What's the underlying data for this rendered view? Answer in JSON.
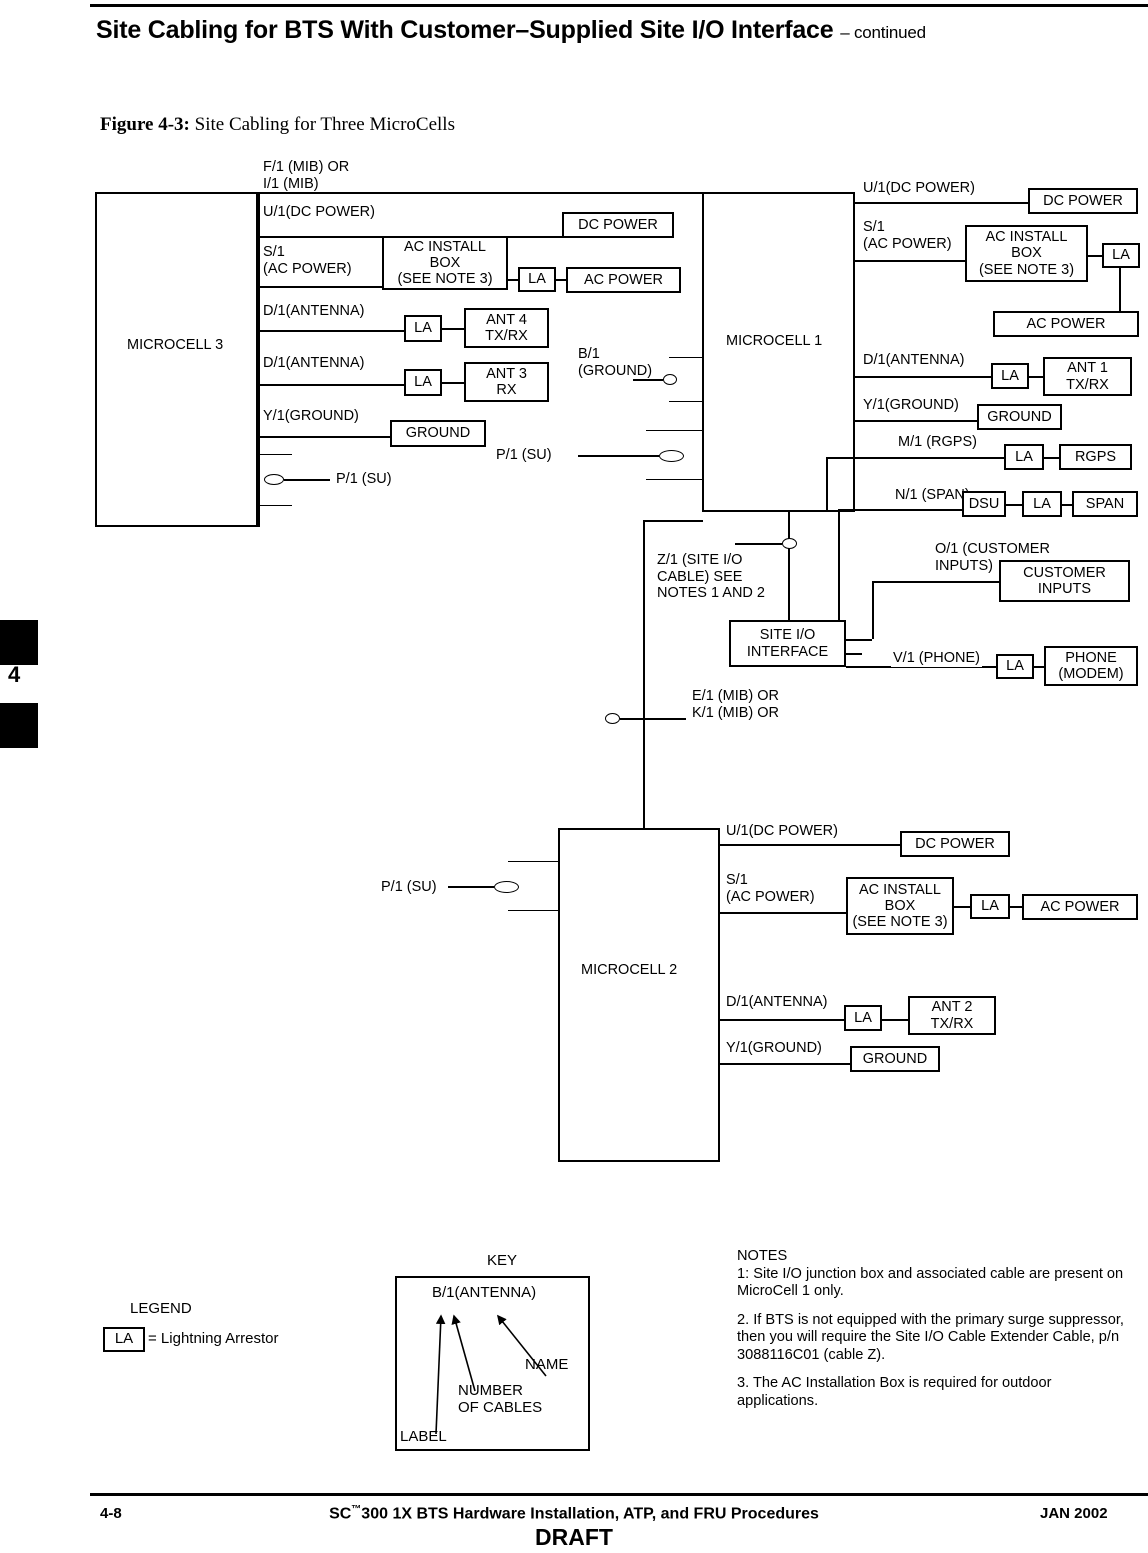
{
  "header": {
    "title_main": "Site Cabling for BTS With Customer–Supplied Site I/O Interface",
    "title_continued": "– continued"
  },
  "figure": {
    "number": "Figure 4-3:",
    "caption": "Site Cabling for Three MicroCells"
  },
  "chapter_tab": {
    "number": "4"
  },
  "diagram": {
    "microcell3": {
      "title": "MICROCELL 3",
      "top_label": "F/1 (MIB) OR\nI/1 (MIB)",
      "ports": {
        "dc": "U/1(DC POWER)",
        "ac": "S/1\n(AC POWER)",
        "ant4": "D/1(ANTENNA)",
        "ant3": "D/1(ANTENNA)",
        "ground": "Y/1(GROUND)",
        "su": "P/1 (SU)"
      },
      "devices": {
        "dc_power": "DC POWER",
        "ac_install_box": "AC INSTALL\nBOX\n(SEE NOTE 3)",
        "la": "LA",
        "ac_power": "AC POWER",
        "ant4": "ANT 4\nTX/RX",
        "ant3": "ANT 3\nRX",
        "ground": "GROUND"
      }
    },
    "microcell1": {
      "title": "MICROCELL 1",
      "ports": {
        "dc": "U/1(DC POWER)",
        "ac": "S/1\n(AC POWER)",
        "ant1": "D/1(ANTENNA)",
        "ground": "Y/1(GROUND)",
        "rgps": "M/1 (RGPS)",
        "span": "N/1 (SPAN)",
        "ground_left": "B/1\n(GROUND)",
        "su_left": "P/1 (SU)"
      },
      "devices": {
        "dc_power": "DC POWER",
        "ac_install_box": "AC INSTALL\nBOX\n(SEE NOTE 3)",
        "la": "LA",
        "ac_power": "AC POWER",
        "ant1": "ANT 1\nTX/RX",
        "ground": "GROUND",
        "rgps": "RGPS",
        "dsu": "DSU",
        "span": "SPAN"
      }
    },
    "site_io": {
      "title": "SITE I/O\nINTERFACE",
      "cable_label": "Z/1 (SITE I/O\nCABLE) SEE\nNOTES 1 AND 2",
      "mib_label": "E/1 (MIB) OR\nK/1 (MIB) OR",
      "customer_inputs_port": "O/1 (CUSTOMER\nINPUTS)",
      "customer_inputs_box": "CUSTOMER\nINPUTS",
      "phone_port": "V/1 (PHONE)",
      "phone_la": "LA",
      "phone_box": "PHONE\n(MODEM)"
    },
    "microcell2": {
      "title": "MICROCELL 2",
      "ports": {
        "su_left": "P/1 (SU)",
        "dc": "U/1(DC POWER)",
        "ac": "S/1\n(AC POWER)",
        "ant2": "D/1(ANTENNA)",
        "ground": "Y/1(GROUND)"
      },
      "devices": {
        "dc_power": "DC POWER",
        "ac_install_box": "AC INSTALL\nBOX\n(SEE NOTE 3)",
        "la": "LA",
        "ac_power": "AC POWER",
        "ant2": "ANT 2\nTX/RX",
        "ground": "GROUND"
      }
    }
  },
  "legend": {
    "title": "LEGEND",
    "symbol": "LA",
    "text": "= Lightning  Arrestor"
  },
  "key": {
    "title": "KEY",
    "sample": "B/1(ANTENNA)",
    "name": "NAME",
    "number_of_cables": "NUMBER\nOF CABLES",
    "label": "LABEL"
  },
  "notes": {
    "title": "NOTES",
    "items": [
      "1:  Site I/O junction box and associated cable are present on MicroCell 1 only.",
      "2.  If BTS is not equipped with the primary surge suppressor, then you will require the Site I/O Cable Extender Cable, p/n 3088116C01 (cable Z).",
      "3.  The AC Installation Box is required for outdoor applications."
    ]
  },
  "footer": {
    "page": "4-8",
    "title_prefix": "SC",
    "title_tm": "™",
    "title_rest": "300 1X BTS Hardware Installation, ATP, and FRU Procedures",
    "date": "JAN 2002",
    "draft": "DRAFT"
  }
}
